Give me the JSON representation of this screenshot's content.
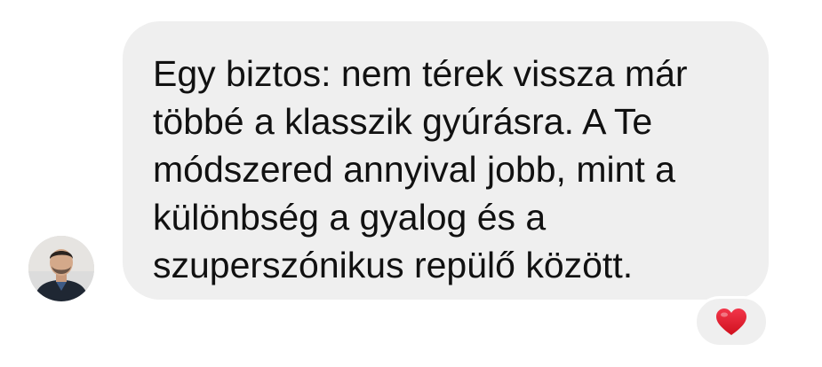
{
  "message": {
    "lines": [
      "Egy biztos: nem térek vissza már",
      "többé a klasszik gyúrásra. A Te",
      "módszered annyival jobb, mint a",
      "különbség a gyalog és a",
      "szuperszónikus repülő között."
    ],
    "bubble_color": "#efefef",
    "text_color": "#111111"
  },
  "reaction": {
    "icon": "heart-icon",
    "color": "#e8202c"
  },
  "sender": {
    "avatar": "avatar"
  }
}
